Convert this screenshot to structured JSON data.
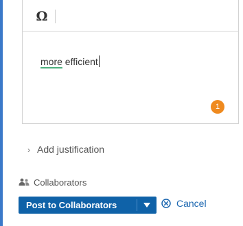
{
  "editor": {
    "toolbar": {
      "special_char_icon": "omega-icon",
      "special_char_glyph": "Ω"
    },
    "content": {
      "misspelled_word": "more",
      "text": " efficient"
    },
    "issue_count": "1"
  },
  "justification": {
    "label": "Add justification",
    "icon": "chevron-right-icon",
    "chevron": "›"
  },
  "collaborators": {
    "label": "Collaborators",
    "icon": "people-icon"
  },
  "actions": {
    "post_label": "Post to Collaborators",
    "post_dropdown_icon": "caret-down-icon",
    "post_dropdown_glyph": "▼",
    "cancel_label": "Cancel",
    "cancel_icon": "circle-x-icon"
  },
  "colors": {
    "primary": "#0f62a8",
    "link": "#1a66b0",
    "badge": "#ef8a1f",
    "spell_underline": "#4caf7d"
  }
}
